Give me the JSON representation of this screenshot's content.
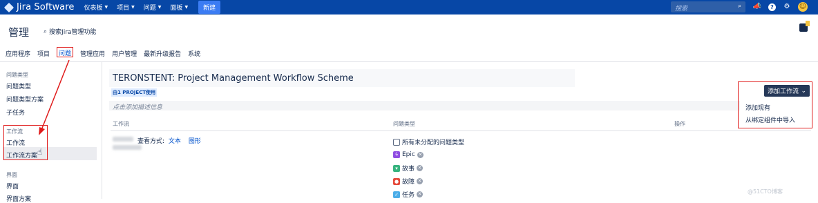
{
  "topbar": {
    "app_name": "Jira Software",
    "menu": [
      "仪表板",
      "项目",
      "问题",
      "面板"
    ],
    "create_label": "新建",
    "search_placeholder": "搜索"
  },
  "header": {
    "title": "管理",
    "search_admin": "搜索Jira管理功能"
  },
  "tabs": [
    "应用程序",
    "项目",
    "问题",
    "管理应用",
    "用户管理",
    "最新升级报告",
    "系统"
  ],
  "active_tab": "问题",
  "sidebar": {
    "groups": [
      {
        "title": "问题类型",
        "items": [
          "问题类型",
          "问题类型方案",
          "子任务"
        ]
      },
      {
        "title": "工作流",
        "items": [
          "工作流",
          "工作流方案"
        ]
      },
      {
        "title": "界面",
        "items": [
          "界面",
          "界面方案"
        ]
      }
    ],
    "selected": "工作流方案"
  },
  "main": {
    "title": "TERONSTENT: Project Management Workflow Scheme",
    "used_by": "由1 PROJECT使用",
    "description_placeholder": "点击添加描述信息",
    "columns": {
      "workflow": "工作流",
      "issue_types": "问题类型",
      "actions": "操作"
    },
    "view_mode_label": "查看方式:",
    "view_text": "文本",
    "view_graph": "图形",
    "issue_types": [
      {
        "label": "所有未分配的问题类型",
        "color": "#ffffff"
      },
      {
        "label": "Epic",
        "color": "#904ee2"
      },
      {
        "label": "故事",
        "color": "#36b37e"
      },
      {
        "label": "故障",
        "color": "#e5493a"
      },
      {
        "label": "任务",
        "color": "#4bade8"
      }
    ]
  },
  "add_workflow": {
    "button_label": "添加工作流",
    "options": [
      "添加现有",
      "从绑定组件中导入"
    ]
  },
  "watermark": "@51CTO博客"
}
